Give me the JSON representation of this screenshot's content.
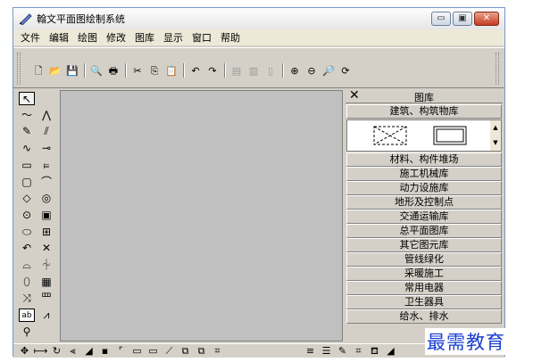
{
  "window": {
    "title": "翰文平面图绘制系统"
  },
  "titlebar_buttons": [
    {
      "name": "minimize-button",
      "glyph": "▭"
    },
    {
      "name": "maximize-button",
      "glyph": "▣"
    },
    {
      "name": "close-button",
      "glyph": "✕"
    }
  ],
  "menu": [
    "文件",
    "编辑",
    "绘图",
    "修改",
    "图库",
    "显示",
    "窗口",
    "帮助"
  ],
  "toolbar": [
    {
      "icon": "new-file-icon",
      "glyph": "🗋"
    },
    {
      "icon": "open-folder-icon",
      "glyph": "📂"
    },
    {
      "icon": "save-icon",
      "glyph": "💾"
    },
    {
      "sep": true
    },
    {
      "icon": "print-preview-icon",
      "glyph": "🔍"
    },
    {
      "icon": "print-icon",
      "glyph": "🖶"
    },
    {
      "sep": true
    },
    {
      "icon": "cut-icon",
      "glyph": "✂"
    },
    {
      "icon": "copy-icon",
      "glyph": "⎘"
    },
    {
      "icon": "paste-icon",
      "glyph": "📋"
    },
    {
      "sep": true
    },
    {
      "icon": "undo-icon",
      "glyph": "↶"
    },
    {
      "icon": "redo-icon",
      "glyph": "↷"
    },
    {
      "sep": true
    },
    {
      "icon": "group-icon",
      "glyph": "▤",
      "dim": true
    },
    {
      "icon": "ungroup-icon",
      "glyph": "▥",
      "dim": true
    },
    {
      "icon": "frame-icon",
      "glyph": "▯",
      "dim": true
    },
    {
      "sep": true
    },
    {
      "icon": "zoom-in-icon",
      "glyph": "⊕"
    },
    {
      "icon": "zoom-out-icon",
      "glyph": "⊖"
    },
    {
      "icon": "zoom-fit-icon",
      "glyph": "🔎"
    },
    {
      "icon": "zoom-refresh-icon",
      "glyph": "⟳"
    }
  ],
  "left_tools": [
    {
      "icon": "select-arrow-icon",
      "glyph": "↖",
      "selected": true
    },
    {
      "icon": "polyline-icon",
      "glyph": "〜"
    },
    {
      "icon": "broken-line-icon",
      "glyph": "⋀"
    },
    {
      "icon": "pencil-icon",
      "glyph": "✎"
    },
    {
      "icon": "hatch-line-icon",
      "glyph": "⫽"
    },
    {
      "icon": "curve-icon",
      "glyph": "∿"
    },
    {
      "icon": "line-dot-icon",
      "glyph": "⊸"
    },
    {
      "icon": "rectangle-icon",
      "glyph": "▭"
    },
    {
      "icon": "dimension-icon",
      "glyph": "⫢"
    },
    {
      "icon": "rounded-rect-icon",
      "glyph": "▢"
    },
    {
      "icon": "arc-line-icon",
      "glyph": "⌒"
    },
    {
      "icon": "diamond-icon",
      "glyph": "◇"
    },
    {
      "icon": "target-icon",
      "glyph": "◎"
    },
    {
      "icon": "circle-icon",
      "glyph": "⊙"
    },
    {
      "icon": "frame-tool-icon",
      "glyph": "▣"
    },
    {
      "icon": "ellipse-icon",
      "glyph": "⬭"
    },
    {
      "icon": "grid-icon",
      "glyph": "⊞"
    },
    {
      "icon": "arc-icon",
      "glyph": "↶"
    },
    {
      "icon": "cross-icon",
      "glyph": "✕"
    },
    {
      "icon": "half-circle-icon",
      "glyph": "⌓"
    },
    {
      "icon": "wave-line-icon",
      "glyph": "⏆"
    },
    {
      "icon": "leaf-icon",
      "glyph": "⬯"
    },
    {
      "icon": "brick-icon",
      "glyph": "▦"
    },
    {
      "icon": "scissor-icon",
      "glyph": "⤨"
    },
    {
      "icon": "table-icon",
      "glyph": "罒"
    },
    {
      "icon": "text-ab-icon",
      "glyph": "ab"
    },
    {
      "icon": "chart-icon",
      "glyph": "⩘"
    },
    {
      "icon": "person-icon",
      "glyph": "⚲"
    }
  ],
  "panel": {
    "title": "图库",
    "close_glyph": "✕",
    "categories": [
      "建筑、构筑物库",
      "材料、构件堆场",
      "施工机械库",
      "动力设施库",
      "地形及控制点",
      "交通运输库",
      "总平面图库",
      "其它图元库",
      "管线绿化",
      "采暖施工",
      "常用电器",
      "卫生器具",
      "给水、排水"
    ]
  },
  "bottom_tools_left": [
    {
      "icon": "move-icon",
      "glyph": "✥"
    },
    {
      "icon": "align-icon",
      "glyph": "⟼"
    },
    {
      "icon": "rotate-icon",
      "glyph": "↻"
    },
    {
      "icon": "mirror-icon",
      "glyph": "⫷"
    },
    {
      "icon": "fill-icon",
      "glyph": "◢"
    },
    {
      "icon": "point-icon",
      "glyph": "▪"
    },
    {
      "icon": "corner-icon",
      "glyph": "⌜"
    },
    {
      "icon": "rect-a-icon",
      "glyph": "▭"
    },
    {
      "icon": "rect-b-icon",
      "glyph": "▭"
    },
    {
      "icon": "line-icon",
      "glyph": "⟋"
    },
    {
      "icon": "layer-a-icon",
      "glyph": "⧉"
    },
    {
      "icon": "layer-b-icon",
      "glyph": "⧉"
    },
    {
      "icon": "bracket-icon",
      "glyph": "⌗"
    }
  ],
  "bottom_tools_right": [
    {
      "icon": "line-style-icon",
      "glyph": "≡"
    },
    {
      "icon": "line-weight-icon",
      "glyph": "☰"
    },
    {
      "icon": "color-pen-icon",
      "glyph": "✎"
    },
    {
      "icon": "pattern-icon",
      "glyph": "⌗"
    },
    {
      "icon": "bucket-icon",
      "glyph": "⛾"
    },
    {
      "icon": "triangle-icon",
      "glyph": "◢"
    }
  ],
  "watermark": "最需教育"
}
